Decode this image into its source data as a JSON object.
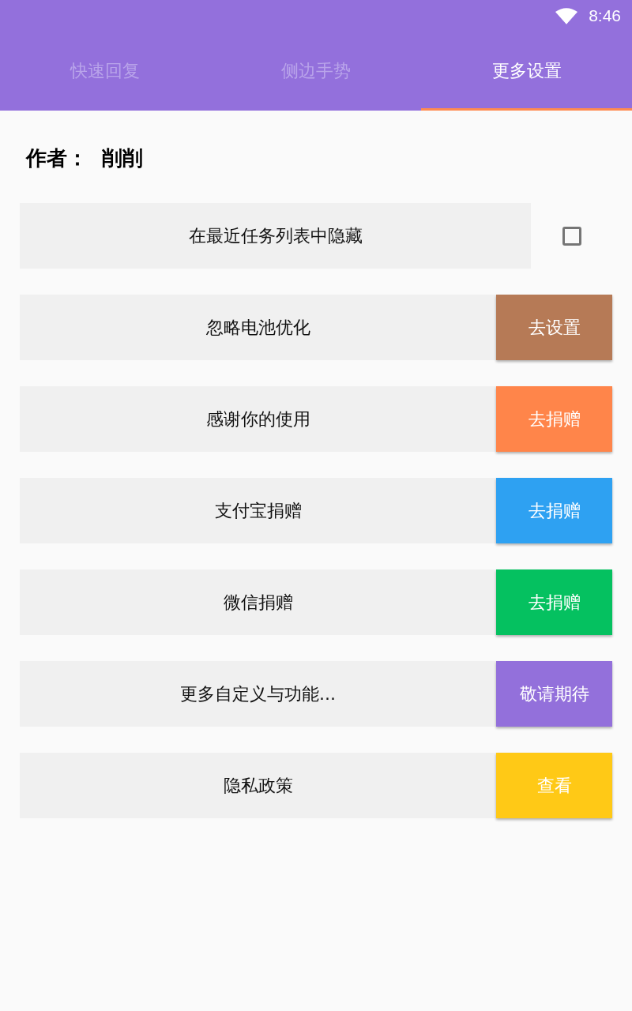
{
  "status_bar": {
    "time": "8:46"
  },
  "tabs": [
    {
      "label": "快速回复",
      "selected": false
    },
    {
      "label": "侧边手势",
      "selected": false
    },
    {
      "label": "更多设置",
      "selected": true
    }
  ],
  "author": {
    "label": "作者：",
    "name": "削削"
  },
  "rows": [
    {
      "kind": "checkbox",
      "label": "在最近任务列表中隐藏",
      "checked": false
    },
    {
      "kind": "button",
      "label": "忽略电池优化",
      "button": "去设置",
      "color": "#b67a56"
    },
    {
      "kind": "button",
      "label": "感谢你的使用",
      "button": "去捐赠",
      "color": "#ff854a"
    },
    {
      "kind": "button",
      "label": "支付宝捐赠",
      "button": "去捐赠",
      "color": "#2ea1f2"
    },
    {
      "kind": "button",
      "label": "微信捐赠",
      "button": "去捐赠",
      "color": "#05c160"
    },
    {
      "kind": "button",
      "label": "更多自定义与功能...",
      "button": "敬请期待",
      "color": "#9370db"
    },
    {
      "kind": "button",
      "label": "隐私政策",
      "button": "查看",
      "color": "#ffc916"
    }
  ]
}
